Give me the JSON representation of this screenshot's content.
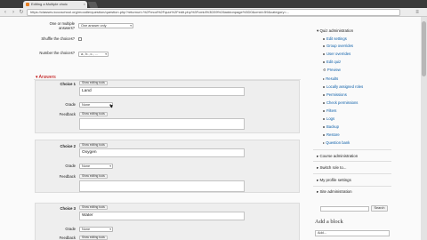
{
  "browser": {
    "tab_title": "Editing a Multiple choic",
    "tab_close": "×",
    "url": "https://classes.kcccschool.org/moodle/question/question.php?returnurl=%2Fmod%2Fquiz%2Fedit.php%3Fcmid%3D59%26addonpage%3D0&cmid=59&category=...",
    "back": "‹",
    "forward": "›",
    "reload": "↻",
    "menu": "≡"
  },
  "form": {
    "one_or_multiple_label": "One or multiple answers?",
    "one_or_multiple_value": "One answer only",
    "shuffle_label": "Shuffle the choices?",
    "number_label": "Number the choices?",
    "number_value": "a., b., c., ...",
    "help": "?",
    "caret": "▾"
  },
  "answers": {
    "section_title": "▾ Answers",
    "show_editing_tools": "Show editing tools",
    "grade_label": "Grade",
    "feedback_label": "Feedback",
    "grade_value": "None",
    "choices": [
      {
        "label": "Choice 1",
        "answer": "Land"
      },
      {
        "label": "Choice 2",
        "answer": "Oxygen"
      },
      {
        "label": "Choice 3",
        "answer": "Water"
      }
    ]
  },
  "sidebar": {
    "quiz_admin": "Quiz administration",
    "items": [
      "Edit settings",
      "Group overrides",
      "User overrides",
      "Edit quiz",
      "Preview",
      "Results",
      "Locally assigned roles",
      "Permissions",
      "Check permissions",
      "Filters",
      "Logs",
      "Backup",
      "Restore",
      "Question bank"
    ],
    "course_admin": "Course administration",
    "switch_role": "Switch role to...",
    "profile_settings": "My profile settings",
    "site_admin": "Site administration",
    "search_button": "Search",
    "add_block_title": "Add a block",
    "add_block_value": "Add..."
  }
}
